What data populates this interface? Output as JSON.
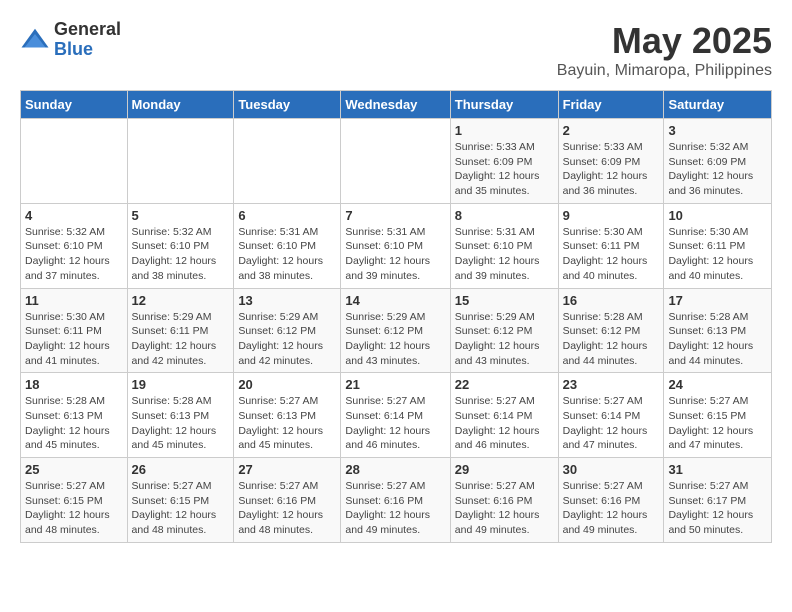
{
  "logo": {
    "general": "General",
    "blue": "Blue"
  },
  "title": "May 2025",
  "subtitle": "Bayuin, Mimaropa, Philippines",
  "weekdays": [
    "Sunday",
    "Monday",
    "Tuesday",
    "Wednesday",
    "Thursday",
    "Friday",
    "Saturday"
  ],
  "weeks": [
    [
      {
        "day": "",
        "info": ""
      },
      {
        "day": "",
        "info": ""
      },
      {
        "day": "",
        "info": ""
      },
      {
        "day": "",
        "info": ""
      },
      {
        "day": "1",
        "info": "Sunrise: 5:33 AM\nSunset: 6:09 PM\nDaylight: 12 hours\nand 35 minutes."
      },
      {
        "day": "2",
        "info": "Sunrise: 5:33 AM\nSunset: 6:09 PM\nDaylight: 12 hours\nand 36 minutes."
      },
      {
        "day": "3",
        "info": "Sunrise: 5:32 AM\nSunset: 6:09 PM\nDaylight: 12 hours\nand 36 minutes."
      }
    ],
    [
      {
        "day": "4",
        "info": "Sunrise: 5:32 AM\nSunset: 6:10 PM\nDaylight: 12 hours\nand 37 minutes."
      },
      {
        "day": "5",
        "info": "Sunrise: 5:32 AM\nSunset: 6:10 PM\nDaylight: 12 hours\nand 38 minutes."
      },
      {
        "day": "6",
        "info": "Sunrise: 5:31 AM\nSunset: 6:10 PM\nDaylight: 12 hours\nand 38 minutes."
      },
      {
        "day": "7",
        "info": "Sunrise: 5:31 AM\nSunset: 6:10 PM\nDaylight: 12 hours\nand 39 minutes."
      },
      {
        "day": "8",
        "info": "Sunrise: 5:31 AM\nSunset: 6:10 PM\nDaylight: 12 hours\nand 39 minutes."
      },
      {
        "day": "9",
        "info": "Sunrise: 5:30 AM\nSunset: 6:11 PM\nDaylight: 12 hours\nand 40 minutes."
      },
      {
        "day": "10",
        "info": "Sunrise: 5:30 AM\nSunset: 6:11 PM\nDaylight: 12 hours\nand 40 minutes."
      }
    ],
    [
      {
        "day": "11",
        "info": "Sunrise: 5:30 AM\nSunset: 6:11 PM\nDaylight: 12 hours\nand 41 minutes."
      },
      {
        "day": "12",
        "info": "Sunrise: 5:29 AM\nSunset: 6:11 PM\nDaylight: 12 hours\nand 42 minutes."
      },
      {
        "day": "13",
        "info": "Sunrise: 5:29 AM\nSunset: 6:12 PM\nDaylight: 12 hours\nand 42 minutes."
      },
      {
        "day": "14",
        "info": "Sunrise: 5:29 AM\nSunset: 6:12 PM\nDaylight: 12 hours\nand 43 minutes."
      },
      {
        "day": "15",
        "info": "Sunrise: 5:29 AM\nSunset: 6:12 PM\nDaylight: 12 hours\nand 43 minutes."
      },
      {
        "day": "16",
        "info": "Sunrise: 5:28 AM\nSunset: 6:12 PM\nDaylight: 12 hours\nand 44 minutes."
      },
      {
        "day": "17",
        "info": "Sunrise: 5:28 AM\nSunset: 6:13 PM\nDaylight: 12 hours\nand 44 minutes."
      }
    ],
    [
      {
        "day": "18",
        "info": "Sunrise: 5:28 AM\nSunset: 6:13 PM\nDaylight: 12 hours\nand 45 minutes."
      },
      {
        "day": "19",
        "info": "Sunrise: 5:28 AM\nSunset: 6:13 PM\nDaylight: 12 hours\nand 45 minutes."
      },
      {
        "day": "20",
        "info": "Sunrise: 5:27 AM\nSunset: 6:13 PM\nDaylight: 12 hours\nand 45 minutes."
      },
      {
        "day": "21",
        "info": "Sunrise: 5:27 AM\nSunset: 6:14 PM\nDaylight: 12 hours\nand 46 minutes."
      },
      {
        "day": "22",
        "info": "Sunrise: 5:27 AM\nSunset: 6:14 PM\nDaylight: 12 hours\nand 46 minutes."
      },
      {
        "day": "23",
        "info": "Sunrise: 5:27 AM\nSunset: 6:14 PM\nDaylight: 12 hours\nand 47 minutes."
      },
      {
        "day": "24",
        "info": "Sunrise: 5:27 AM\nSunset: 6:15 PM\nDaylight: 12 hours\nand 47 minutes."
      }
    ],
    [
      {
        "day": "25",
        "info": "Sunrise: 5:27 AM\nSunset: 6:15 PM\nDaylight: 12 hours\nand 48 minutes."
      },
      {
        "day": "26",
        "info": "Sunrise: 5:27 AM\nSunset: 6:15 PM\nDaylight: 12 hours\nand 48 minutes."
      },
      {
        "day": "27",
        "info": "Sunrise: 5:27 AM\nSunset: 6:16 PM\nDaylight: 12 hours\nand 48 minutes."
      },
      {
        "day": "28",
        "info": "Sunrise: 5:27 AM\nSunset: 6:16 PM\nDaylight: 12 hours\nand 49 minutes."
      },
      {
        "day": "29",
        "info": "Sunrise: 5:27 AM\nSunset: 6:16 PM\nDaylight: 12 hours\nand 49 minutes."
      },
      {
        "day": "30",
        "info": "Sunrise: 5:27 AM\nSunset: 6:16 PM\nDaylight: 12 hours\nand 49 minutes."
      },
      {
        "day": "31",
        "info": "Sunrise: 5:27 AM\nSunset: 6:17 PM\nDaylight: 12 hours\nand 50 minutes."
      }
    ]
  ]
}
